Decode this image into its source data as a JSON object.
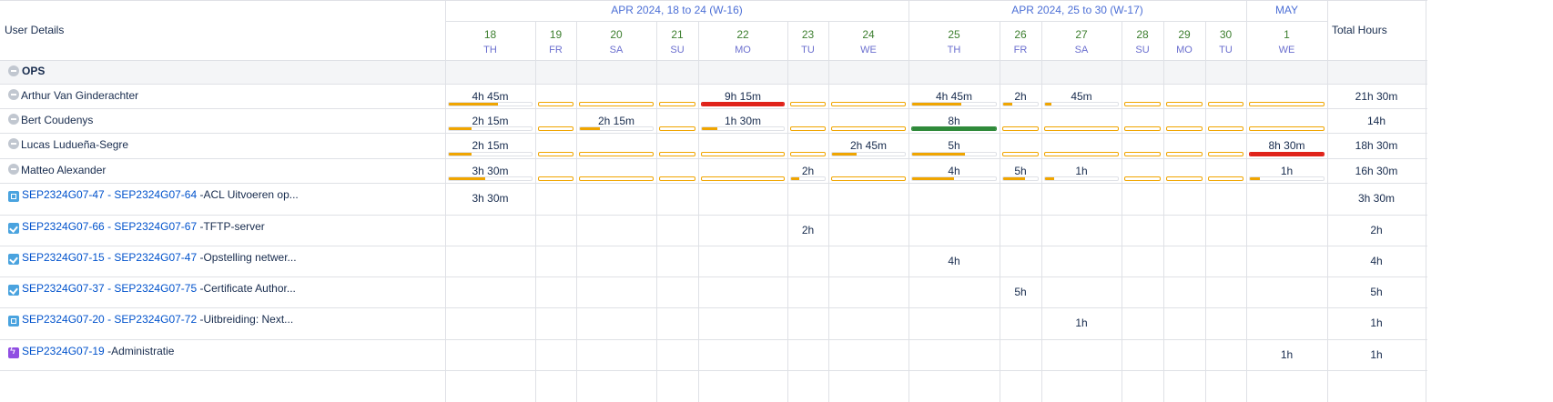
{
  "header": {
    "user_details": "User Details",
    "total_hours": "Total Hours",
    "weeks": [
      "APR 2024, 18 to 24 (W-16)",
      "APR 2024, 25 to 30 (W-17)",
      "MAY"
    ],
    "days": [
      {
        "num": "18",
        "name": "TH"
      },
      {
        "num": "19",
        "name": "FR"
      },
      {
        "num": "20",
        "name": "SA"
      },
      {
        "num": "21",
        "name": "SU"
      },
      {
        "num": "22",
        "name": "MO"
      },
      {
        "num": "23",
        "name": "TU"
      },
      {
        "num": "24",
        "name": "WE"
      },
      {
        "num": "25",
        "name": "TH"
      },
      {
        "num": "26",
        "name": "FR"
      },
      {
        "num": "27",
        "name": "SA"
      },
      {
        "num": "28",
        "name": "SU"
      },
      {
        "num": "29",
        "name": "MO"
      },
      {
        "num": "30",
        "name": "TU"
      },
      {
        "num": "1",
        "name": "WE"
      }
    ]
  },
  "group": {
    "name": "OPS"
  },
  "users": [
    {
      "name": "Arthur Van Ginderachter",
      "total": "21h 30m",
      "cells": [
        "4h 45m",
        "",
        "",
        "",
        "9h 15m",
        "",
        "",
        "4h 45m",
        "2h",
        "45m",
        "",
        "",
        "",
        ""
      ],
      "status": [
        "under",
        "none",
        "none",
        "none",
        "over",
        "none",
        "none",
        "under",
        "under",
        "under",
        "none",
        "none",
        "none",
        "none"
      ],
      "fill": [
        0.59,
        0,
        0,
        0,
        1,
        0,
        0,
        0.59,
        0.25,
        0.09,
        0,
        0,
        0,
        0
      ]
    },
    {
      "name": "Bert Coudenys",
      "total": "14h",
      "cells": [
        "2h 15m",
        "",
        "2h 15m",
        "",
        "1h 30m",
        "",
        "",
        "8h",
        "",
        "",
        "",
        "",
        "",
        ""
      ],
      "status": [
        "under",
        "none",
        "under",
        "none",
        "under",
        "none",
        "none",
        "full",
        "none",
        "none",
        "none",
        "none",
        "none",
        "none"
      ],
      "fill": [
        0.28,
        0,
        0.28,
        0,
        0.19,
        0,
        0,
        1,
        0,
        0,
        0,
        0,
        0,
        0
      ]
    },
    {
      "name": "Lucas Ludueña-Segre",
      "total": "18h 30m",
      "cells": [
        "2h 15m",
        "",
        "",
        "",
        "",
        "",
        "2h 45m",
        "5h",
        "",
        "",
        "",
        "",
        "",
        "8h 30m"
      ],
      "status": [
        "under",
        "none",
        "none",
        "none",
        "none",
        "none",
        "under",
        "under",
        "none",
        "none",
        "none",
        "none",
        "none",
        "over"
      ],
      "fill": [
        0.28,
        0,
        0,
        0,
        0,
        0,
        0.34,
        0.63,
        0,
        0,
        0,
        0,
        0,
        1
      ]
    },
    {
      "name": "Matteo Alexander",
      "total": "16h 30m",
      "cells": [
        "3h 30m",
        "",
        "",
        "",
        "",
        "2h",
        "",
        "4h",
        "5h",
        "1h",
        "",
        "",
        "",
        "1h"
      ],
      "status": [
        "under",
        "none",
        "none",
        "none",
        "none",
        "under",
        "none",
        "under",
        "under",
        "under",
        "none",
        "none",
        "none",
        "under"
      ],
      "fill": [
        0.44,
        0,
        0,
        0,
        0,
        0.25,
        0,
        0.5,
        0.63,
        0.13,
        0,
        0,
        0,
        0.13
      ]
    }
  ],
  "tickets": [
    {
      "icon": "story",
      "key": "SEP2324G07-47 - SEP2324G07-64",
      "summary": " -ACL Uitvoeren op...",
      "total": "3h 30m",
      "cells": [
        "3h 30m",
        "",
        "",
        "",
        "",
        "",
        "",
        "",
        "",
        "",
        "",
        "",
        "",
        ""
      ]
    },
    {
      "icon": "task",
      "key": "SEP2324G07-66 - SEP2324G07-67",
      "summary": " -TFTP-server",
      "total": "2h",
      "cells": [
        "",
        "",
        "",
        "",
        "",
        "2h",
        "",
        "",
        "",
        "",
        "",
        "",
        "",
        ""
      ]
    },
    {
      "icon": "task",
      "key": "SEP2324G07-15 - SEP2324G07-47",
      "summary": " -Opstelling netwer...",
      "total": "4h",
      "cells": [
        "",
        "",
        "",
        "",
        "",
        "",
        "",
        "4h",
        "",
        "",
        "",
        "",
        "",
        ""
      ]
    },
    {
      "icon": "task",
      "key": "SEP2324G07-37 - SEP2324G07-75",
      "summary": " -Certificate Author...",
      "total": "5h",
      "cells": [
        "",
        "",
        "",
        "",
        "",
        "",
        "",
        "",
        "5h",
        "",
        "",
        "",
        "",
        ""
      ]
    },
    {
      "icon": "story",
      "key": "SEP2324G07-20 - SEP2324G07-72",
      "summary": " -Uitbreiding: Next...",
      "total": "1h",
      "cells": [
        "",
        "",
        "",
        "",
        "",
        "",
        "",
        "",
        "",
        "1h",
        "",
        "",
        "",
        ""
      ]
    },
    {
      "icon": "epic",
      "key": "SEP2324G07-19",
      "summary": " -Administratie",
      "total": "1h",
      "cells": [
        "",
        "",
        "",
        "",
        "",
        "",
        "",
        "",
        "",
        "",
        "",
        "",
        "",
        "1h"
      ]
    }
  ]
}
